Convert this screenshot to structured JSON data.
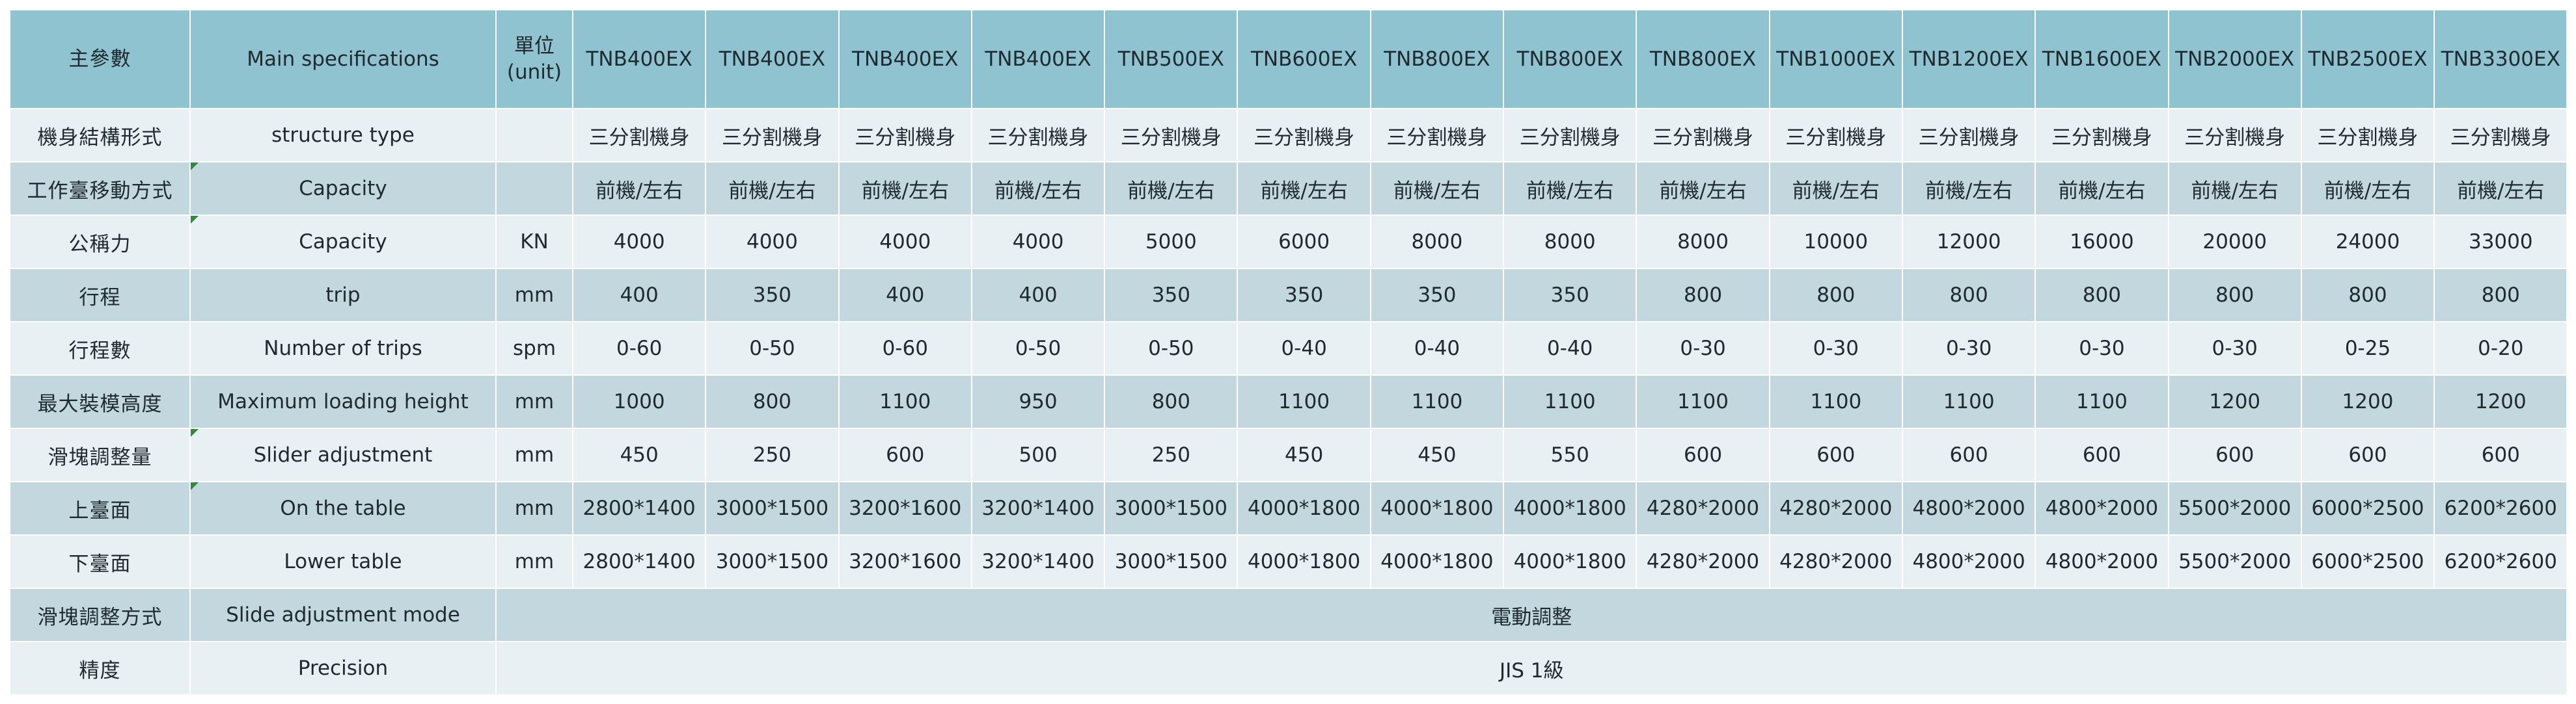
{
  "header": {
    "cn_param": "主參數",
    "en_spec": "Main specifications",
    "unit_line1": "單位",
    "unit_line2": "(unit)",
    "models": [
      "TNB400EX",
      "TNB400EX",
      "TNB400EX",
      "TNB400EX",
      "TNB500EX",
      "TNB600EX",
      "TNB800EX",
      "TNB800EX",
      "TNB800EX",
      "TNB1000EX",
      "TNB1200EX",
      "TNB1600EX",
      "TNB2000EX",
      "TNB2500EX",
      "TNB3300EX"
    ]
  },
  "rows": [
    {
      "cn": "機身結構形式",
      "en": "structure type",
      "unit": "",
      "values": [
        "三分割機身",
        "三分割機身",
        "三分割機身",
        "三分割機身",
        "三分割機身",
        "三分割機身",
        "三分割機身",
        "三分割機身",
        "三分割機身",
        "三分割機身",
        "三分割機身",
        "三分割機身",
        "三分割機身",
        "三分割機身",
        "三分割機身"
      ]
    },
    {
      "cn": "工作臺移動方式",
      "en": "Capacity",
      "unit": "",
      "values": [
        "前機/左右",
        "前機/左右",
        "前機/左右",
        "前機/左右",
        "前機/左右",
        "前機/左右",
        "前機/左右",
        "前機/左右",
        "前機/左右",
        "前機/左右",
        "前機/左右",
        "前機/左右",
        "前機/左右",
        "前機/左右",
        "前機/左右"
      ]
    },
    {
      "cn": "公稱力",
      "en": "Capacity",
      "unit": "KN",
      "values": [
        "4000",
        "4000",
        "4000",
        "4000",
        "5000",
        "6000",
        "8000",
        "8000",
        "8000",
        "10000",
        "12000",
        "16000",
        "20000",
        "24000",
        "33000"
      ]
    },
    {
      "cn": "行程",
      "en": "trip",
      "unit": "mm",
      "values": [
        "400",
        "350",
        "400",
        "400",
        "350",
        "350",
        "350",
        "350",
        "800",
        "800",
        "800",
        "800",
        "800",
        "800",
        "800"
      ]
    },
    {
      "cn": "行程數",
      "en": "Number of trips",
      "unit": "spm",
      "values": [
        "0-60",
        "0-50",
        "0-60",
        "0-50",
        "0-50",
        "0-40",
        "0-40",
        "0-40",
        "0-30",
        "0-30",
        "0-30",
        "0-30",
        "0-30",
        "0-25",
        "0-20"
      ]
    },
    {
      "cn": "最大裝模高度",
      "en": "Maximum loading height",
      "unit": "mm",
      "values": [
        "1000",
        "800",
        "1100",
        "950",
        "800",
        "1100",
        "1100",
        "1100",
        "1100",
        "1100",
        "1100",
        "1100",
        "1200",
        "1200",
        "1200"
      ]
    },
    {
      "cn": "滑塊調整量",
      "en": "Slider adjustment",
      "unit": "mm",
      "values": [
        "450",
        "250",
        "600",
        "500",
        "250",
        "450",
        "450",
        "550",
        "600",
        "600",
        "600",
        "600",
        "600",
        "600",
        "600"
      ]
    },
    {
      "cn": "上臺面",
      "en": "On the table",
      "unit": "mm",
      "values": [
        "2800*1400",
        "3000*1500",
        "3200*1600",
        "3200*1400",
        "3000*1500",
        "4000*1800",
        "4000*1800",
        "4000*1800",
        "4280*2000",
        "4280*2000",
        "4800*2000",
        "4800*2000",
        "5500*2000",
        "6000*2500",
        "6200*2600"
      ]
    },
    {
      "cn": "下臺面",
      "en": "Lower table",
      "unit": "mm",
      "values": [
        "2800*1400",
        "3000*1500",
        "3200*1600",
        "3200*1400",
        "3000*1500",
        "4000*1800",
        "4000*1800",
        "4000*1800",
        "4280*2000",
        "4280*2000",
        "4800*2000",
        "4800*2000",
        "5500*2000",
        "6000*2500",
        "6200*2600"
      ]
    }
  ],
  "span_rows": [
    {
      "cn": "滑塊調整方式",
      "en": "Slide adjustment mode",
      "value": "電動調整"
    },
    {
      "cn": "精度",
      "en": "Precision",
      "value": "JIS 1級"
    }
  ]
}
